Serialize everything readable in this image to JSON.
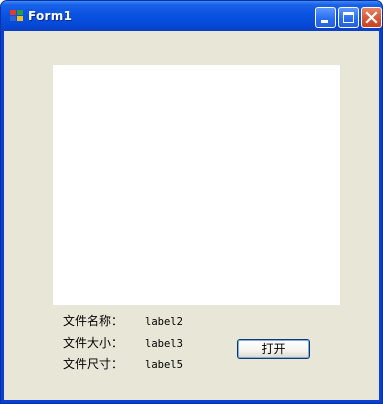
{
  "window": {
    "title": "Form1"
  },
  "labels": {
    "file_name_caption": "文件名称：",
    "file_name_value": "label2",
    "file_size_caption": "文件大小：",
    "file_size_value": "label3",
    "file_dimensions_caption": "文件尺寸：",
    "file_dimensions_value": "label5"
  },
  "buttons": {
    "open_label": "打开"
  },
  "colors": {
    "title_bar": "#0a53e3",
    "client_background": "#ece9d8",
    "picture_box": "#ffffff",
    "close_button": "#d75a3a"
  },
  "icons": {
    "app": "form-app-icon",
    "minimize": "minimize-icon",
    "maximize": "maximize-icon",
    "close": "close-icon"
  }
}
